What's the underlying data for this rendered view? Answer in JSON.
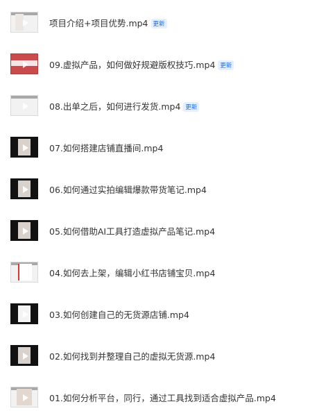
{
  "videos": [
    {
      "title": "项目介绍+项目优势.mp4",
      "badge": "更新",
      "thumbnail": "light"
    },
    {
      "title": "09.虚拟产品，如何做好规避版权技巧.mp4",
      "badge": "更新",
      "thumbnail": "red"
    },
    {
      "title": "08.出单之后，如何进行发货.mp4",
      "badge": "更新",
      "thumbnail": "light"
    },
    {
      "title": "07.如何搭建店铺直播间.mp4",
      "badge": "",
      "thumbnail": "dark"
    },
    {
      "title": "06.如何通过实拍编辑爆款带货笔记.mp4",
      "badge": "",
      "thumbnail": "dark"
    },
    {
      "title": "05.如何借助AI工具打造虚拟产品笔记.mp4",
      "badge": "",
      "thumbnail": "dark"
    },
    {
      "title": "04.如何去上架，编辑小红书店铺宝贝.mp4",
      "badge": "",
      "thumbnail": "light"
    },
    {
      "title": "03.如何创建自己的无货源店铺.mp4",
      "badge": "",
      "thumbnail": "dark"
    },
    {
      "title": "02.如何找到并整理自己的虚拟无货源.mp4",
      "badge": "",
      "thumbnail": "dark"
    },
    {
      "title": "01.如何分析平台，同行，通过工具找到适合虚拟产品.mp4",
      "badge": "",
      "thumbnail": "light"
    }
  ]
}
